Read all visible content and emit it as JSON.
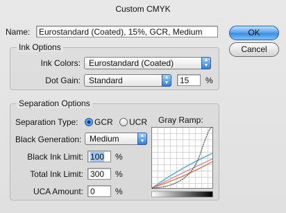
{
  "window": {
    "title": "Custom CMYK"
  },
  "name_field": {
    "label": "Name:",
    "value": "Eurostandard (Coated), 15%, GCR, Medium"
  },
  "buttons": {
    "ok": "OK",
    "cancel": "Cancel"
  },
  "ink_options": {
    "title": "Ink Options",
    "ink_colors_label": "Ink Colors:",
    "ink_colors_value": "Eurostandard (Coated)",
    "dot_gain_label": "Dot Gain:",
    "dot_gain_mode": "Standard",
    "dot_gain_value": "15",
    "dot_gain_unit": "%"
  },
  "separation_options": {
    "title": "Separation Options",
    "type_label": "Separation Type:",
    "type_gcr": "GCR",
    "type_ucr": "UCR",
    "selected_type": "GCR",
    "black_generation_label": "Black Generation:",
    "black_generation_value": "Medium",
    "black_ink_limit_label": "Black Ink Limit:",
    "black_ink_limit_value": "100",
    "total_ink_limit_label": "Total Ink Limit:",
    "total_ink_limit_value": "300",
    "uca_amount_label": "UCA Amount:",
    "uca_amount_value": "0",
    "percent": "%",
    "gray_ramp_label": "Gray Ramp:"
  },
  "colors": {
    "accent_blue": "#3d8ee3",
    "cyan_curve": "#4aa3d8",
    "magenta_curve": "#c77aa0",
    "yellow_curve": "#d8c24a",
    "black_curve": "#222222",
    "orange_curve": "#e8743a"
  }
}
